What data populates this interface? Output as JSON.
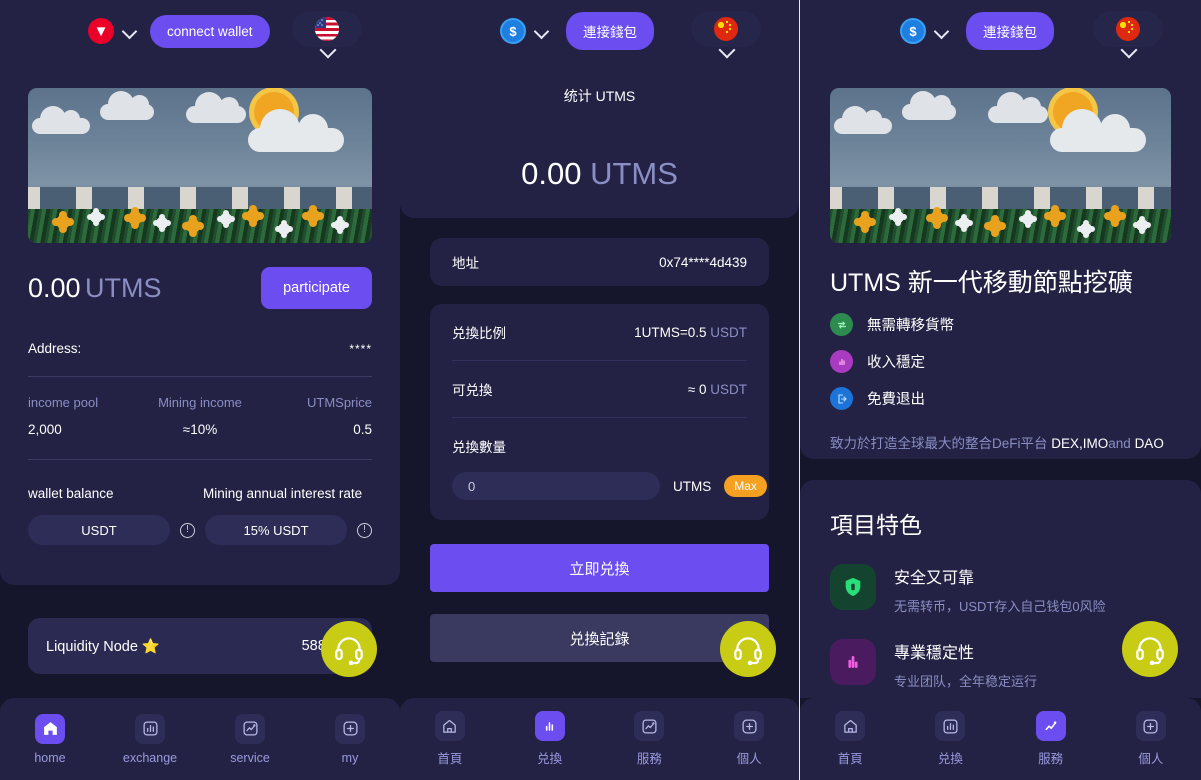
{
  "panel_left": {
    "header": {
      "chain_icon": "tron-icon",
      "chain_chevron": "chevron-down-icon",
      "connect_label": "connect wallet",
      "lang_flag": "us-flag-icon",
      "lang_chevron": "chevron-down-icon"
    },
    "hero_image": "farm-fence-flowers-illustration",
    "balance": {
      "amount": "0.00",
      "unit": "UTMS",
      "participate_label": "participate"
    },
    "address": {
      "label": "Address:",
      "value": "****"
    },
    "stats": {
      "headers": [
        "income pool",
        "Mining income",
        "UTMSprice"
      ],
      "values": [
        "2,000",
        "≈10%",
        "0.5"
      ]
    },
    "wallet": {
      "headers": [
        "wallet balance",
        "Mining annual interest rate"
      ],
      "balance_value": "USDT",
      "rate_value": "15% USDT",
      "info_icon": "info-icon"
    },
    "node": {
      "label": "Liquidity Node ⭐",
      "value": "588,564"
    },
    "nav": [
      {
        "label": "home",
        "icon": "home-icon",
        "active": true
      },
      {
        "label": "exchange",
        "icon": "chart-bars-icon",
        "active": false
      },
      {
        "label": "service",
        "icon": "trend-line-icon",
        "active": false
      },
      {
        "label": "my",
        "icon": "plus-square-icon",
        "active": false
      }
    ],
    "support_icon": "headset-icon"
  },
  "panel_mid": {
    "header": {
      "chain_icon": "usd-coin-icon",
      "chain_chevron": "chevron-down-icon",
      "connect_label": "連接錢包",
      "lang_flag": "cn-flag-icon",
      "lang_chevron": "chevron-down-icon"
    },
    "stat_title": "统计 UTMS",
    "big_amount": "0.00",
    "big_unit": "UTMS",
    "address_row": {
      "label": "地址",
      "value": "0x74****4d439"
    },
    "rate_row": {
      "label": "兑換比例",
      "value": "1UTMS=0.5",
      "unit": "USDT"
    },
    "avail_row": {
      "label": "可兑換",
      "value": "≈ 0",
      "unit": "USDT"
    },
    "amount": {
      "label": "兑換數量",
      "input_value": "0",
      "placeholder": "0",
      "unit": "UTMS",
      "max_label": "Max"
    },
    "primary_btn": "立即兑換",
    "secondary_btn": "兑換記錄",
    "nav": [
      {
        "label": "首頁",
        "icon": "home-icon",
        "active": false
      },
      {
        "label": "兑換",
        "icon": "chart-bars-icon",
        "active": true
      },
      {
        "label": "服務",
        "icon": "trend-line-icon",
        "active": false
      },
      {
        "label": "個人",
        "icon": "plus-square-icon",
        "active": false
      }
    ],
    "support_icon": "headset-icon"
  },
  "panel_right": {
    "header": {
      "chain_icon": "usd-coin-icon",
      "chain_chevron": "chevron-down-icon",
      "connect_label": "連接錢包",
      "lang_flag": "cn-flag-icon",
      "lang_chevron": "chevron-down-icon"
    },
    "hero_image": "farm-fence-flowers-illustration",
    "title": "UTMS 新一代移動節點挖礦",
    "features": [
      {
        "text": "無需轉移貨幣",
        "icon": "transfer-icon",
        "color": "#2e8b4f"
      },
      {
        "text": "收入穩定",
        "icon": "chart-bars-icon",
        "color": "#a83bc0"
      },
      {
        "text": "免費退出",
        "icon": "exit-icon",
        "color": "#1d74d8"
      }
    ],
    "subtitle_plain_1": "致力於打造全球最大的整合DeFi平台 ",
    "subtitle_hl_1": "DEX,IMO",
    "subtitle_plain_2": "and ",
    "subtitle_hl_2": "DAO",
    "section_title": "項目特色",
    "big_features": [
      {
        "heading": "安全又可靠",
        "desc": "无需转币，USDT存入自己钱包0风险",
        "icon": "shield-lock-icon",
        "bg": "#14432f",
        "fg": "#27e07a"
      },
      {
        "heading": "專業穩定性",
        "desc": "专业团队，全年稳定运行",
        "icon": "chart-bars-icon",
        "bg": "#4a1b5e",
        "fg": "#f05de0"
      }
    ],
    "nav": [
      {
        "label": "首頁",
        "icon": "home-icon",
        "active": false
      },
      {
        "label": "兑換",
        "icon": "chart-bars-icon",
        "active": false
      },
      {
        "label": "服務",
        "icon": "trend-line-icon",
        "active": true
      },
      {
        "label": "個人",
        "icon": "plus-square-icon",
        "active": false
      }
    ],
    "support_icon": "headset-icon"
  },
  "colors": {
    "page_bg": "#15152b",
    "card_bg": "#232244",
    "accent_purple": "#6c4df0",
    "muted_text": "#8a8ec4",
    "support_yellow": "#c8cc15",
    "max_orange": "#f5a020"
  }
}
